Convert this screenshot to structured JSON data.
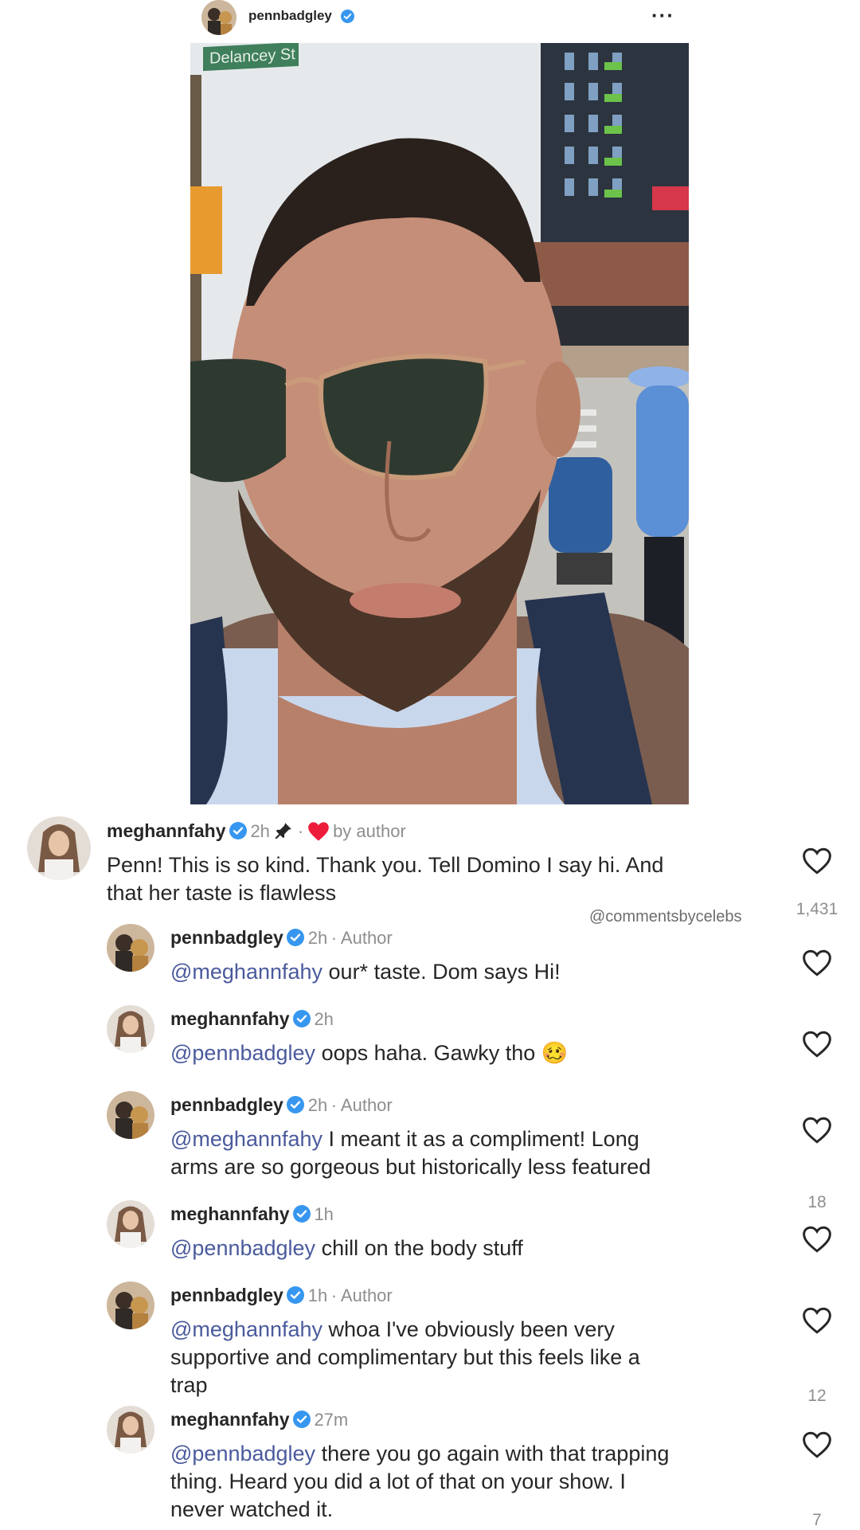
{
  "post": {
    "username": "pennbadgley",
    "more_label": "···",
    "street_sign": "Delancey St"
  },
  "pinned_comment": {
    "username": "meghannfahy",
    "time": "2h",
    "separator": "·",
    "liked_by": "by author",
    "text_line1": "Penn! This is so kind. Thank you. Tell Domino I say hi. And",
    "text_line2": "that her taste is flawless",
    "likes": "1,431"
  },
  "watermark": "@commentsbycelebs",
  "replies": [
    {
      "username": "pennbadgley",
      "time": "2h",
      "author_tag": "· Author",
      "mention": "@meghannfahy",
      "text": " our* taste. Dom says Hi!",
      "text_line2": "",
      "text_line3": "",
      "likes": ""
    },
    {
      "username": "meghannfahy",
      "time": "2h",
      "author_tag": "",
      "mention": "@pennbadgley",
      "text": " oops haha. Gawky tho 🥴",
      "text_line2": "",
      "text_line3": "",
      "likes": ""
    },
    {
      "username": "pennbadgley",
      "time": "2h",
      "author_tag": "· Author",
      "mention": "@meghannfahy",
      "text": " I meant it as a compliment! Long",
      "text_line2": "arms are so gorgeous but historically less featured",
      "text_line3": "",
      "likes": "18"
    },
    {
      "username": "meghannfahy",
      "time": "1h",
      "author_tag": "",
      "mention": "@pennbadgley",
      "text": " chill on the body stuff",
      "text_line2": "",
      "text_line3": "",
      "likes": ""
    },
    {
      "username": "pennbadgley",
      "time": "1h",
      "author_tag": "· Author",
      "mention": "@meghannfahy",
      "text": " whoa I've obviously been very",
      "text_line2": "supportive and complimentary but this feels like a",
      "text_line3": "trap",
      "likes": "12"
    },
    {
      "username": "meghannfahy",
      "time": "27m",
      "author_tag": "",
      "mention": "@pennbadgley",
      "text": " there you go again with that trapping",
      "text_line2": "thing. Heard you did a lot of that on your show. I",
      "text_line3": "never watched it.",
      "likes": "7"
    }
  ],
  "colors": {
    "verified": "#3797f0",
    "heart_liked": "#ed1c3a",
    "mention": "#4a5a9c",
    "meta": "#8e8e8e"
  }
}
